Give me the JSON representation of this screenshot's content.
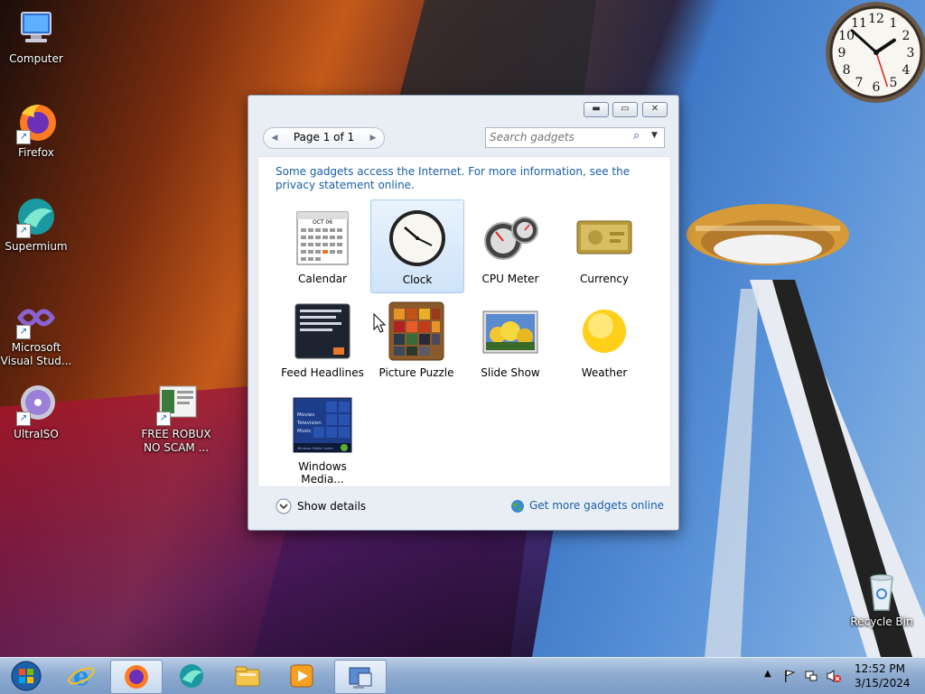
{
  "desktop_icons": [
    {
      "label": "Computer",
      "icon": "computer-icon"
    },
    {
      "label": "Firefox",
      "icon": "firefox-icon"
    },
    {
      "label": "Supermium",
      "icon": "supermium-icon"
    },
    {
      "label": "Microsoft Visual Stud...",
      "icon": "visual-studio-icon"
    },
    {
      "label": "UltraISO",
      "icon": "ultraiso-icon"
    },
    {
      "label": "FREE ROBUX NO SCAM ...",
      "icon": "document-icon"
    },
    {
      "label": "Recycle Bin",
      "icon": "recycle-bin-icon"
    }
  ],
  "clock_gadget": {
    "hour": 1,
    "minute": 52,
    "second": 27,
    "numbers": [
      "12",
      "1",
      "2",
      "3",
      "4",
      "5",
      "6",
      "7",
      "8",
      "9",
      "10",
      "11"
    ]
  },
  "gadget_window": {
    "pager_label": "Page 1 of 1",
    "search_placeholder": "Search gadgets",
    "notice": "Some gadgets access the Internet.  For more information, see the privacy statement online.",
    "gadgets": [
      {
        "name": "Calendar",
        "selected": false
      },
      {
        "name": "Clock",
        "selected": true
      },
      {
        "name": "CPU Meter",
        "selected": false
      },
      {
        "name": "Currency",
        "selected": false
      },
      {
        "name": "Feed Headlines",
        "selected": false
      },
      {
        "name": "Picture Puzzle",
        "selected": false
      },
      {
        "name": "Slide Show",
        "selected": false
      },
      {
        "name": "Weather",
        "selected": false
      },
      {
        "name": "Windows Media...",
        "selected": false
      }
    ],
    "calendar_month": "OCT 06",
    "media_lines": [
      "Movies",
      "Television",
      "Music"
    ],
    "media_footer": "Windows Media Center",
    "show_details": "Show details",
    "get_more": "Get more gadgets online"
  },
  "taskbar": {
    "items": [
      {
        "icon": "start-orb-icon"
      },
      {
        "icon": "internet-explorer-icon"
      },
      {
        "icon": "firefox-icon",
        "active": true
      },
      {
        "icon": "supermium-icon"
      },
      {
        "icon": "file-explorer-icon"
      },
      {
        "icon": "media-player-icon"
      },
      {
        "icon": "gadgets-icon",
        "active": true
      }
    ],
    "time": "12:52 PM",
    "date": "3/15/2024"
  },
  "colors": {
    "link": "#1a5fa8",
    "selection": "#cfe3f8",
    "taskbar": "#8fabd0"
  }
}
